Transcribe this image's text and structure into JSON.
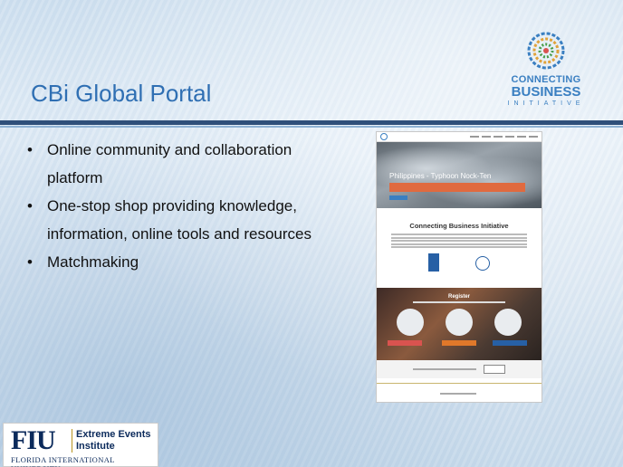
{
  "slide": {
    "title": "CBi Global Portal",
    "bullets": [
      "Online community and collaboration platform",
      "One-stop shop providing knowledge, information, online tools and resources",
      "Matchmaking"
    ],
    "bullet_char": "•"
  },
  "cbi_logo": {
    "line1": "CONNECTING",
    "line2": "BUSINESS",
    "line3": "INITIATIVE",
    "icon": "connecting-business-circle-icon"
  },
  "website_screenshot": {
    "hero_title": "Philippines - Typhoon Nock-Ten",
    "section_title": "Connecting Business Initiative",
    "register_title": "Register"
  },
  "fiu_logo": {
    "mark": "FIU",
    "org_line1": "Extreme Events",
    "org_line2": "Institute",
    "university": "FLORIDA INTERNATIONAL UNIVERSITY"
  },
  "colors": {
    "title_blue": "#2f6fb3",
    "divider_navy": "#2f4f7a",
    "fiu_navy": "#0b2a5b",
    "fiu_gold": "#b8941f",
    "hero_orange": "#e06a3f"
  }
}
